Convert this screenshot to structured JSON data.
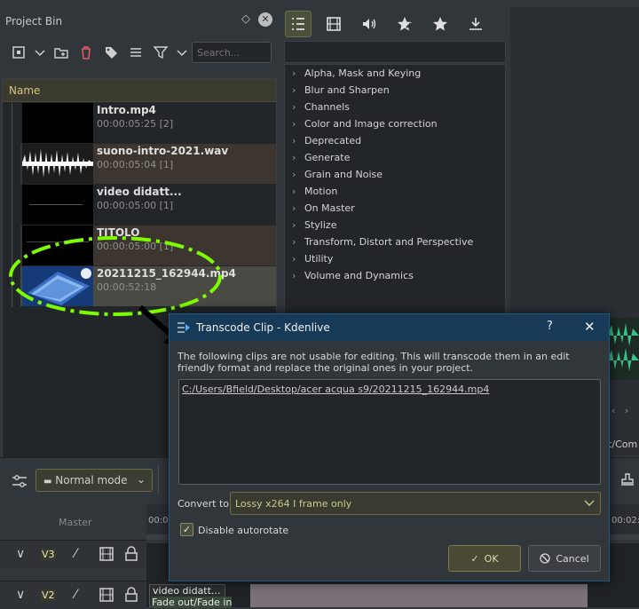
{
  "project_bin": {
    "title": "Project Bin",
    "search_placeholder": "Search...",
    "column_header": "Name",
    "clips": [
      {
        "name": "Intro.mp4",
        "meta": "00:00:05:25 [2]"
      },
      {
        "name": "suono-intro-2021.wav",
        "meta": "00:00:05:04 [1]"
      },
      {
        "name": "video didatt...",
        "meta": "00:00:05:00 [1]"
      },
      {
        "name": "TITOLO",
        "meta": "00:00:05:00 [1]"
      },
      {
        "name": "20211215_162944.mp4",
        "meta": "00:00:52:18"
      }
    ]
  },
  "effects": {
    "categories": [
      "Alpha, Mask and Keying",
      "Blur and Sharpen",
      "Channels",
      "Color and Image correction",
      "Deprecated",
      "Generate",
      "Grain and Noise",
      "Motion",
      "On Master",
      "Stylize",
      "Transform, Distort and Perspective",
      "Utility",
      "Volume and Dynamics"
    ]
  },
  "timeline": {
    "mode": "Normal mode",
    "master_label": "Master",
    "ruler_start": "00:0",
    "ruler_right": "00:02:",
    "tracks": [
      {
        "label": "V3"
      },
      {
        "label": "V2"
      }
    ],
    "clip_title": "video didatt...",
    "clip_effect": "Fade out/Fade in",
    "partial_right_text": "ct/Com"
  },
  "dialog": {
    "title": "Transcode Clip - Kdenlive",
    "help": "?",
    "close": "✕",
    "message": "The following clips are not usable for editing. This will transcode them in an edit friendly format and replace the original ones in your project.",
    "clip_path": "C:/Users/Bfield/Desktop/acer acqua s9/20211215_162944.mp4",
    "convert_label": "Convert to",
    "convert_value": "Lossy x264 I frame only",
    "autorotate_label": "Disable autorotate",
    "autorotate_checked": "✓",
    "ok_label": "OK",
    "cancel_label": "Cancel"
  },
  "annotation_color": "#7cfc00"
}
